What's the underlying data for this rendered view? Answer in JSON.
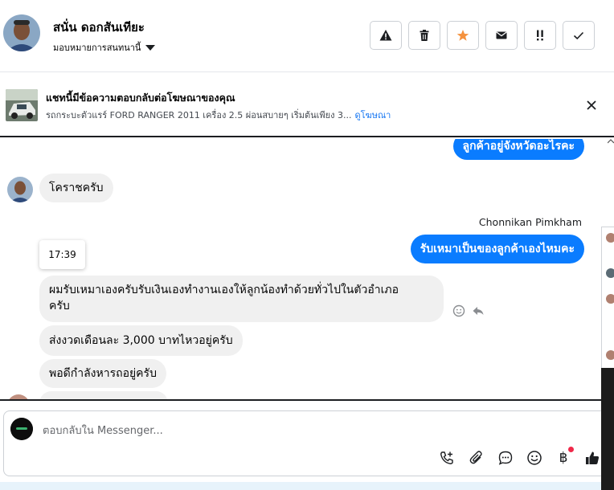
{
  "header": {
    "contact_name": "สนั่น ดอกสันเทียะ",
    "assign_label": "มอบหมายการสนทนานี้",
    "actions": [
      {
        "name": "report-button",
        "icon": "warning-icon"
      },
      {
        "name": "delete-button",
        "icon": "trash-icon"
      },
      {
        "name": "star-button",
        "icon": "star-icon"
      },
      {
        "name": "mark-unread-button",
        "icon": "envelope-icon"
      },
      {
        "name": "follow-up-button",
        "icon": "follow-up-icon"
      },
      {
        "name": "done-button",
        "icon": "check-icon"
      }
    ]
  },
  "ad": {
    "title": "แชทนี้มีข้อความตอบกลับต่อโฆษณาของคุณ",
    "description": "รถกระบะตัวแรร์ FORD RANGER 2011 เครื่อง 2.5 ผ่อนสบายๆ เริ่มต้นเพียง 3...",
    "link": "ดูโฆษณา"
  },
  "messages": {
    "out_1": "ลูกค้าอยู่จังหวัดอะไรคะ",
    "in_1": "โคราชครับ",
    "sender_name": "Chonnikan Pimkham",
    "out_2": "รับเหมาเป็นของลูกค้าเองไหมคะ",
    "time": "17:39",
    "in_2_line1": "ผมรับเหมาเองครับรับเงินเองทำงานเองให้ลูกน้องทำด้วยทั่วไปในตัวอำเภอ",
    "in_2_line2": "ครับ",
    "in_3": "ส่งงวดเดือนละ 3,000 บาทไหวอยู่ครับ",
    "in_4": "พอดีกำลังหารถอยู่ครับ"
  },
  "composer": {
    "placeholder": "ตอบกลับใน Messenger...",
    "tools": [
      "call-add-icon",
      "attachment-icon",
      "saved-reply-icon",
      "emoji-icon",
      "payment-icon",
      "thumbs-up-icon"
    ],
    "payment_symbol": "฿"
  },
  "colors": {
    "accent": "#0a7cff",
    "incoming_bubble": "#f0f0f0",
    "star": "#f5923e",
    "link": "#1877f2",
    "notification_dot": "#f02849"
  }
}
